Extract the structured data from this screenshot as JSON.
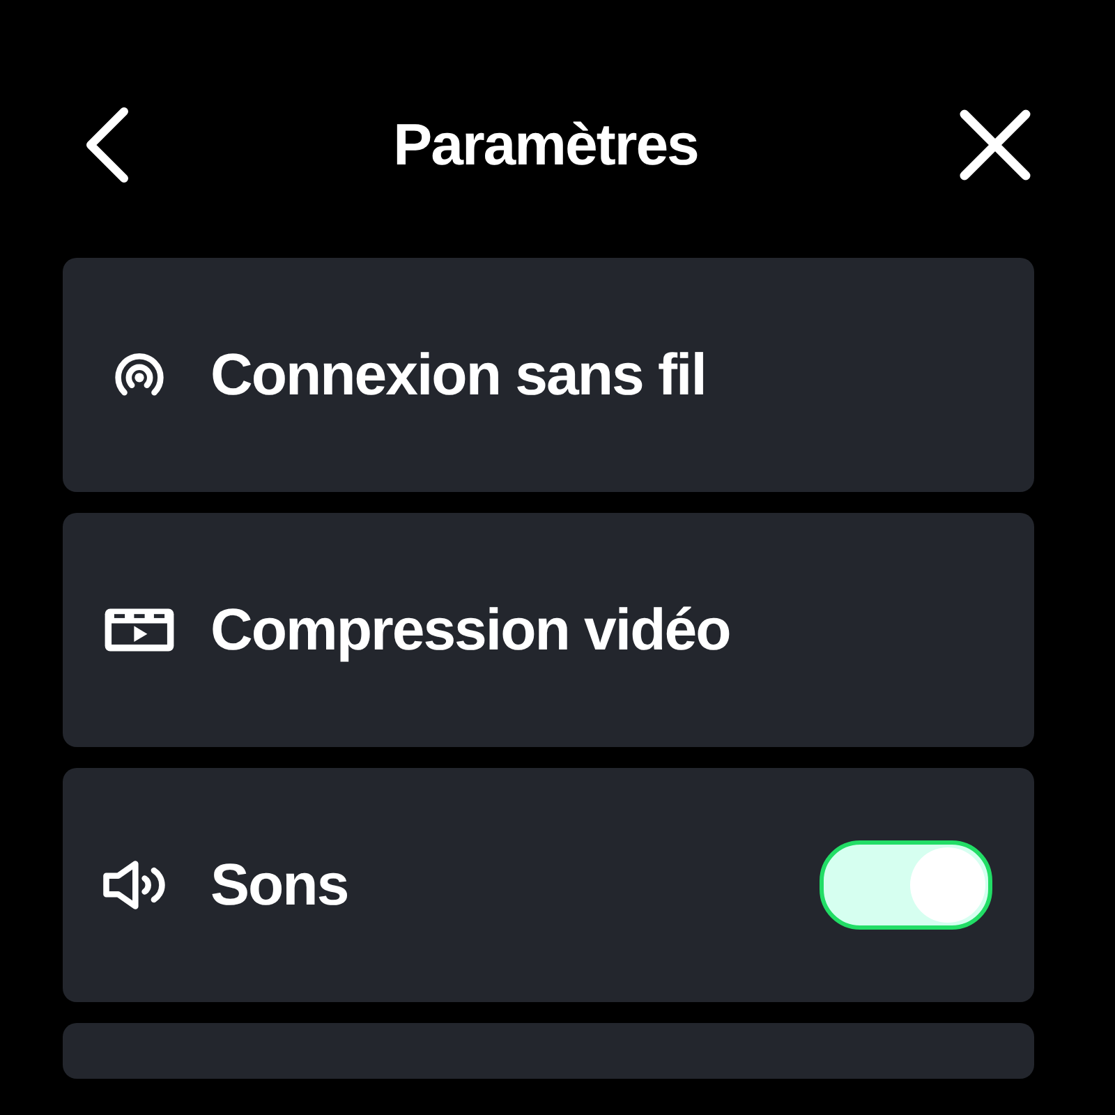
{
  "header": {
    "title": "Paramètres"
  },
  "items": [
    {
      "kind": "nav",
      "label": "Connexion sans fil"
    },
    {
      "kind": "nav",
      "label": "Compression vidéo"
    },
    {
      "kind": "toggle",
      "label": "Sons",
      "on": true
    },
    {
      "kind": "blank"
    }
  ]
}
